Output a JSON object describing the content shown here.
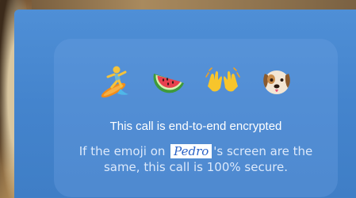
{
  "encryption_card": {
    "emojis": [
      "surfer-emoji",
      "watermelon-emoji",
      "raised-hands-emoji",
      "dog-face-emoji"
    ],
    "title": "This call is end-to-end encrypted",
    "body_prefix": "If the emoji on",
    "contact_name": "Pedro",
    "body_suffix": "'s screen are the same, this call is 100% secure."
  },
  "colors": {
    "background_blue": "#4484cd",
    "card_tint": "#6ea0e1",
    "text": "#ffffff"
  }
}
